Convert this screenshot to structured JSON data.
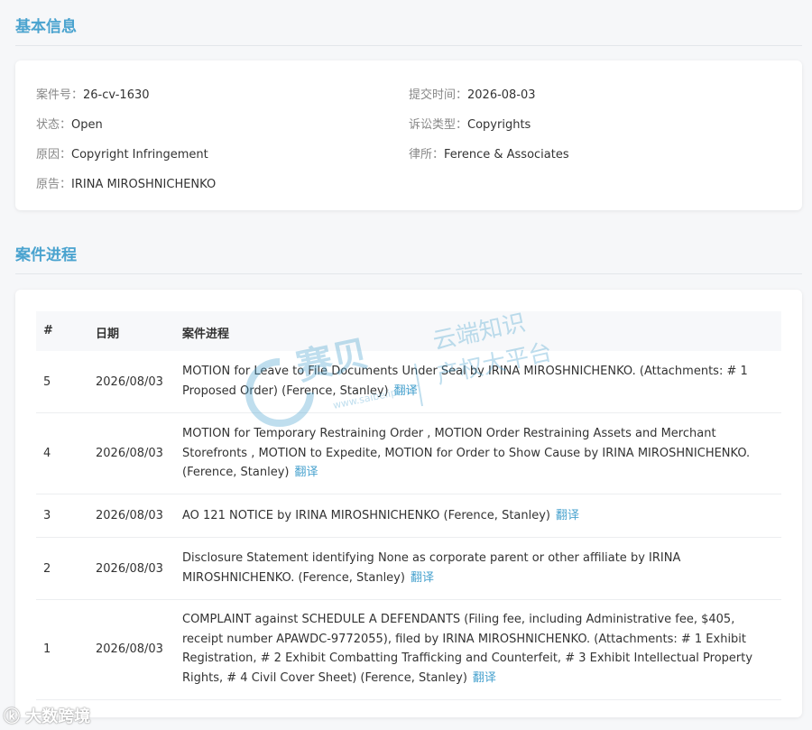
{
  "basic_info": {
    "title": "基本信息",
    "fields": [
      {
        "label": "案件号：",
        "value": "26-cv-1630"
      },
      {
        "label": "提交时间：",
        "value": "2026-08-03"
      },
      {
        "label": "状态：",
        "value": "Open"
      },
      {
        "label": "诉讼类型：",
        "value": "Copyrights"
      },
      {
        "label": "原因：",
        "value": "Copyright Infringement"
      },
      {
        "label": "律所：",
        "value": "Ference & Associates"
      },
      {
        "label": "原告：",
        "value": "IRINA MIROSHNICHENKO"
      }
    ]
  },
  "progress": {
    "title": "案件进程",
    "headers": {
      "num": "#",
      "date": "日期",
      "desc": "案件进程"
    },
    "translate_label": "翻译",
    "rows": [
      {
        "num": "5",
        "date": "2026/08/03",
        "desc": "MOTION for Leave to File Documents Under Seal by IRINA MIROSHNICHENKO. (Attachments: # 1 Proposed Order) (Ference, Stanley)"
      },
      {
        "num": "4",
        "date": "2026/08/03",
        "desc": "MOTION for Temporary Restraining Order , MOTION Order Restraining Assets and Merchant Storefronts , MOTION to Expedite, MOTION for Order to Show Cause by IRINA MIROSHNICHENKO. (Ference, Stanley)"
      },
      {
        "num": "3",
        "date": "2026/08/03",
        "desc": "AO 121 NOTICE by IRINA MIROSHNICHENKO (Ference, Stanley)"
      },
      {
        "num": "2",
        "date": "2026/08/03",
        "desc": "Disclosure Statement identifying None as corporate parent or other affiliate by IRINA MIROSHNICHENKO. (Ference, Stanley)"
      },
      {
        "num": "1",
        "date": "2026/08/03",
        "desc": "COMPLAINT against SCHEDULE A DEFENDANTS (Filing fee, including Administrative fee, $405, receipt number APAWDC-9772055), filed by IRINA MIROSHNICHENKO. (Attachments: # 1 Exhibit Registration, # 2 Exhibit Combatting Trafficking and Counterfeit, # 3 Exhibit Intellectual Property Rights, # 4 Civil Cover Sheet) (Ference, Stanley)"
      }
    ]
  },
  "watermark": {
    "brand": "赛贝",
    "slogan_1": "云端知识",
    "slogan_2": "产权大平台",
    "url": "www.saibeiip.com"
  },
  "footer_watermark": "大数跨境",
  "colors": {
    "accent": "#4aa3cf"
  }
}
